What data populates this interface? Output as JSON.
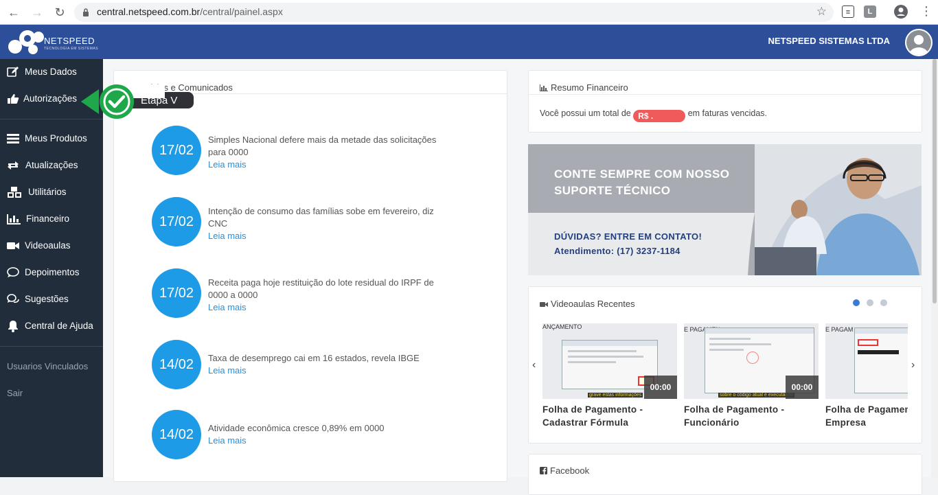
{
  "browser": {
    "url_host": "central.netspeed.com.br",
    "url_path": "/central/painel.aspx",
    "ext1": "",
    "ext2": "L"
  },
  "header": {
    "logo_text": "NETSPEED",
    "logo_sub": "TECNOLOGIA EM SISTEMAS",
    "company": "NETSPEED SISTEMAS LTDA"
  },
  "sidebar": {
    "items": [
      {
        "label": "Meus Dados",
        "icon": "edit-icon"
      },
      {
        "label": "Autorizações",
        "icon": "thumbs-up-icon"
      },
      {
        "label": "Meus Produtos",
        "icon": "list-icon"
      },
      {
        "label": "Atualizações",
        "icon": "refresh-icon"
      },
      {
        "label": "Utilitários",
        "icon": "cubes-icon"
      },
      {
        "label": "Financeiro",
        "icon": "bar-chart-icon"
      },
      {
        "label": "Videoaulas",
        "icon": "video-icon"
      },
      {
        "label": "Depoimentos",
        "icon": "comment-icon"
      },
      {
        "label": "Sugestões",
        "icon": "comments-icon"
      },
      {
        "label": "Central de Ajuda",
        "icon": "bell-icon"
      }
    ],
    "linked_users": "Usuarios Vinculados",
    "logout": "Sair"
  },
  "callout": {
    "label": "Etapa V"
  },
  "news": {
    "title": "Notícias e Comunicados",
    "more_label": "Leia mais",
    "items": [
      {
        "date": "17/02",
        "text": "Simples Nacional defere mais da metade das solicitações para 0000"
      },
      {
        "date": "17/02",
        "text": "Intenção de consumo das famílias sobe em fevereiro, diz CNC"
      },
      {
        "date": "17/02",
        "text": "Receita paga hoje restituição do lote residual do IRPF de 0000 a 0000"
      },
      {
        "date": "14/02",
        "text": "Taxa de desemprego cai em 16 estados, revela IBGE"
      },
      {
        "date": "14/02",
        "text": "Atividade econômica cresce 0,89% em 0000"
      }
    ]
  },
  "finance": {
    "title": "Resumo Financeiro",
    "text_before": "Você possui um total de",
    "amount": "R$        .",
    "text_after": "em faturas vencidas."
  },
  "banner": {
    "line1": "CONTE SEMPRE COM NOSSO",
    "line2": "SUPORTE TÉCNICO",
    "line3": "DÚVIDAS? ENTRE EM CONTATO!",
    "line4": "Atendimento: (17) 3237-1184"
  },
  "videos": {
    "title": "Videoaulas Recentes",
    "items": [
      {
        "title_line1": "Folha de Pagamento -",
        "title_line2": "Cadastrar Fórmula",
        "duration": "00:00",
        "caption": "grave estas informações",
        "header_text": "ANÇAMENTO"
      },
      {
        "title_line1": "Folha de Pagamento -",
        "title_line2": "Funcionário",
        "duration": "00:00",
        "caption": "sobre o código atual e executando",
        "header_text": "E PAGAMEN"
      },
      {
        "title_line1": "Folha de Pagament",
        "title_line2": "Empresa",
        "duration": "",
        "caption": "",
        "header_text": "E PAGAM"
      }
    ]
  },
  "facebook": {
    "title": "Facebook"
  },
  "colors": {
    "topbar": "#2d4f9a",
    "sidebar": "#212d3b",
    "date_circle": "#1e9be6",
    "link": "#2a8fd8",
    "badge": "#f05a5a",
    "callout_green": "#1fa84a"
  }
}
